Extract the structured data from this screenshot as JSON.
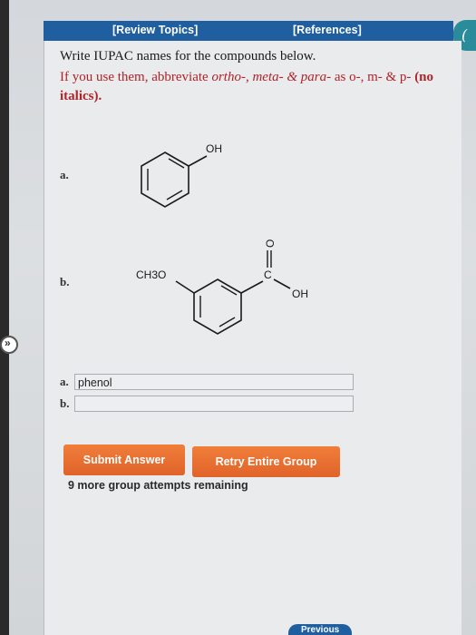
{
  "header": {
    "review_topics": "[Review Topics]",
    "references": "[References]"
  },
  "instructions": {
    "main": "Write IUPAC names for the compounds below.",
    "note_prefix": "If you use them, abbreviate ",
    "note_terms": "ortho-, meta- & para-",
    "note_middle": " as o-, m- & p- ",
    "note_suffix": "(no italics)."
  },
  "compounds": {
    "a": {
      "label": "a.",
      "substituent": "OH"
    },
    "b": {
      "label": "b.",
      "methoxy": "CH3O",
      "carbonyl_o": "O",
      "carbonyl_c": "C",
      "acid_oh": "OH"
    }
  },
  "answers": {
    "a": {
      "label": "a.",
      "value": "phenol"
    },
    "b": {
      "label": "b.",
      "value": ""
    }
  },
  "buttons": {
    "submit": "Submit Answer",
    "retry": "Retry Entire Group"
  },
  "attempts_text": "9 more group attempts remaining",
  "nav": {
    "previous": "Previous"
  },
  "colors": {
    "header_blue": "#1f5fa0",
    "button_orange": "#e8702f",
    "note_red": "#b0232a"
  }
}
